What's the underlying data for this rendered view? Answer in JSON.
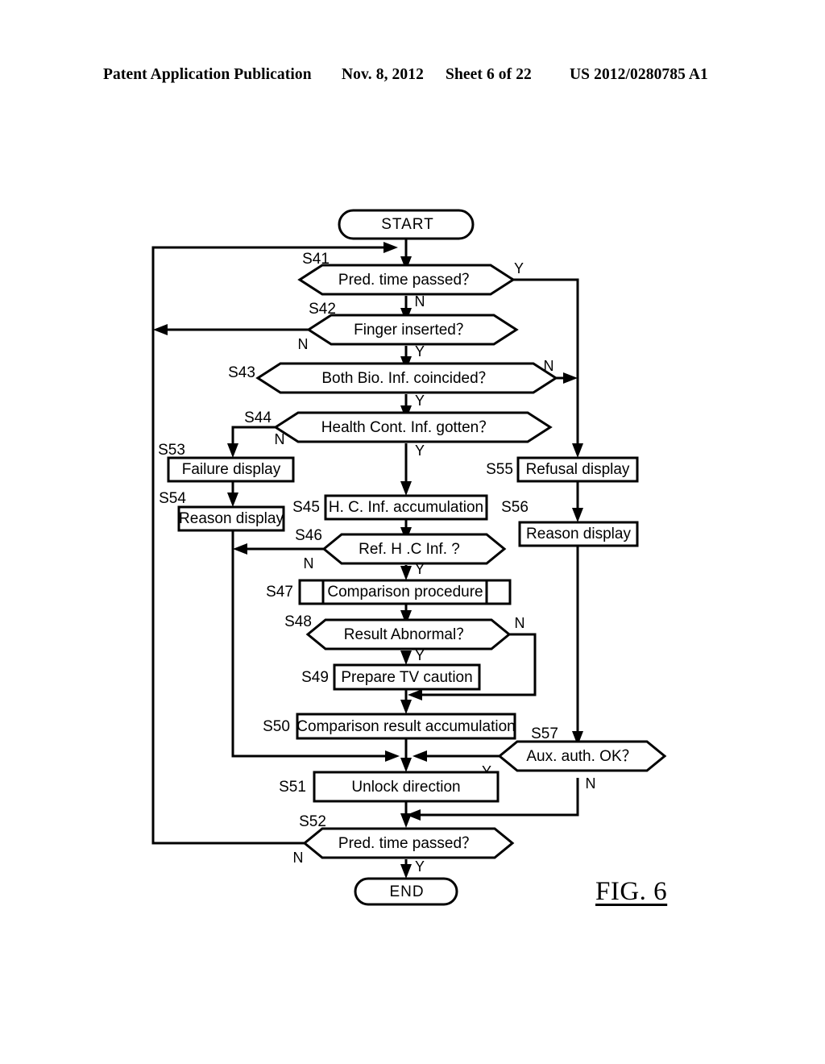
{
  "header": {
    "publication": "Patent Application Publication",
    "date": "Nov. 8, 2012",
    "sheet": "Sheet 6 of 22",
    "number": "US 2012/0280785 A1"
  },
  "figure": {
    "label": "FIG. 6"
  },
  "chart_data": {
    "type": "diagram",
    "diagram_type": "flowchart",
    "title": "FIG. 6",
    "nodes": [
      {
        "id": "start",
        "step": "",
        "shape": "terminator",
        "text": "START"
      },
      {
        "id": "s41",
        "step": "S41",
        "shape": "decision",
        "text": "Pred. time passed？"
      },
      {
        "id": "s42",
        "step": "S42",
        "shape": "decision",
        "text": "Finger inserted？"
      },
      {
        "id": "s43",
        "step": "S43",
        "shape": "decision",
        "text": "Both Bio. Inf. coincided？"
      },
      {
        "id": "s44",
        "step": "S44",
        "shape": "decision",
        "text": "Health Cont. Inf. gotten？"
      },
      {
        "id": "s53",
        "step": "S53",
        "shape": "process",
        "text": "Failure display"
      },
      {
        "id": "s54",
        "step": "S54",
        "shape": "process",
        "text": "Reason display"
      },
      {
        "id": "s45",
        "step": "S45",
        "shape": "process",
        "text": "H. C. Inf. accumulation"
      },
      {
        "id": "s55",
        "step": "S55",
        "shape": "process",
        "text": "Refusal display"
      },
      {
        "id": "s56",
        "step": "S56",
        "shape": "process",
        "text": "Reason display"
      },
      {
        "id": "s46",
        "step": "S46",
        "shape": "decision",
        "text": "Ref. H .C Inf. ?"
      },
      {
        "id": "s47",
        "step": "S47",
        "shape": "predefined-process",
        "text": "Comparison procedure"
      },
      {
        "id": "s48",
        "step": "S48",
        "shape": "decision",
        "text": "Result Abnormal？"
      },
      {
        "id": "s49",
        "step": "S49",
        "shape": "process",
        "text": "Prepare TV caution"
      },
      {
        "id": "s50",
        "step": "S50",
        "shape": "process",
        "text": "Comparison result accumulation"
      },
      {
        "id": "s57",
        "step": "S57",
        "shape": "decision",
        "text": "Aux. auth. OK？"
      },
      {
        "id": "s51",
        "step": "S51",
        "shape": "process",
        "text": "Unlock direction"
      },
      {
        "id": "s52",
        "step": "S52",
        "shape": "decision",
        "text": "Pred. time passed？"
      },
      {
        "id": "end",
        "step": "",
        "shape": "terminator",
        "text": "END"
      }
    ],
    "edges": [
      {
        "from": "start",
        "to": "s41",
        "label": ""
      },
      {
        "from": "s41",
        "to": "s55",
        "label": "Y"
      },
      {
        "from": "s41",
        "to": "s42",
        "label": "N"
      },
      {
        "from": "s42",
        "to": "s41",
        "label": "N"
      },
      {
        "from": "s42",
        "to": "s43",
        "label": "Y"
      },
      {
        "from": "s43",
        "to": "s55",
        "label": "N"
      },
      {
        "from": "s43",
        "to": "s44",
        "label": "Y"
      },
      {
        "from": "s44",
        "to": "s53",
        "label": "N"
      },
      {
        "from": "s44",
        "to": "s45",
        "label": "Y"
      },
      {
        "from": "s53",
        "to": "s54",
        "label": ""
      },
      {
        "from": "s54",
        "to": "s51",
        "label": ""
      },
      {
        "from": "s45",
        "to": "s46",
        "label": ""
      },
      {
        "from": "s46",
        "to": "s54",
        "label": "N"
      },
      {
        "from": "s46",
        "to": "s47",
        "label": "Y"
      },
      {
        "from": "s47",
        "to": "s48",
        "label": ""
      },
      {
        "from": "s48",
        "to": "s50",
        "label": "N"
      },
      {
        "from": "s48",
        "to": "s49",
        "label": "Y"
      },
      {
        "from": "s49",
        "to": "s50",
        "label": ""
      },
      {
        "from": "s50",
        "to": "s51",
        "label": ""
      },
      {
        "from": "s55",
        "to": "s56",
        "label": ""
      },
      {
        "from": "s56",
        "to": "s57",
        "label": ""
      },
      {
        "from": "s57",
        "to": "s51",
        "label": "Y"
      },
      {
        "from": "s57",
        "to": "s52",
        "label": "N"
      },
      {
        "from": "s51",
        "to": "s52",
        "label": ""
      },
      {
        "from": "s52",
        "to": "s41",
        "label": "N"
      },
      {
        "from": "s52",
        "to": "end",
        "label": "Y"
      }
    ],
    "branch_labels": [
      "Y",
      "N"
    ]
  }
}
